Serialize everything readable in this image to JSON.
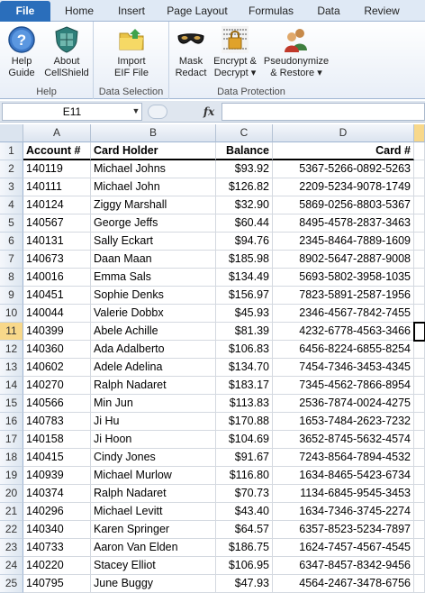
{
  "ribbon": {
    "tabs": [
      "File",
      "Home",
      "Insert",
      "Page Layout",
      "Formulas",
      "Data",
      "Review"
    ],
    "groups": [
      {
        "label": "Help",
        "buttons": [
          {
            "line1": "Help",
            "line2": "Guide",
            "icon": "help-icon"
          },
          {
            "line1": "About",
            "line2": "CellShield",
            "icon": "shield-icon"
          }
        ]
      },
      {
        "label": "Data Selection",
        "buttons": [
          {
            "line1": "Import",
            "line2": "EIF File",
            "icon": "folder-icon"
          }
        ]
      },
      {
        "label": "Data Protection",
        "buttons": [
          {
            "line1": "Mask",
            "line2": "Redact",
            "icon": "mask-icon"
          },
          {
            "line1": "Encrypt &",
            "line2": "Decrypt ▾",
            "icon": "lock-icon"
          },
          {
            "line1": "Pseudonymize",
            "line2": "& Restore ▾",
            "icon": "people-icon"
          }
        ]
      }
    ]
  },
  "formula_bar": {
    "name_box": "E11",
    "fx": "fx",
    "value": ""
  },
  "grid": {
    "columns": [
      "A",
      "B",
      "C",
      "D"
    ],
    "selected_cell": "E11",
    "headers": [
      "Account #",
      "Card Holder",
      "Balance",
      "Card #"
    ],
    "rows": [
      [
        "140119",
        "Michael Johns",
        "$93.92",
        "5367-5266-0892-5263"
      ],
      [
        "140111",
        "Michael John",
        "$126.82",
        "2209-5234-9078-1749"
      ],
      [
        "140124",
        "Ziggy Marshall",
        "$32.90",
        "5869-0256-8803-5367"
      ],
      [
        "140567",
        "George Jeffs",
        "$60.44",
        "8495-4578-2837-3463"
      ],
      [
        "140131",
        "Sally Eckart",
        "$94.76",
        "2345-8464-7889-1609"
      ],
      [
        "140673",
        "Daan Maan",
        "$185.98",
        "8902-5647-2887-9008"
      ],
      [
        "140016",
        "Emma Sals",
        "$134.49",
        "5693-5802-3958-1035"
      ],
      [
        "140451",
        "Sophie Denks",
        "$156.97",
        "7823-5891-2587-1956"
      ],
      [
        "140044",
        "Valerie Dobbx",
        "$45.93",
        "2346-4567-7842-7455"
      ],
      [
        "140399",
        "Abele Achille",
        "$81.39",
        "4232-6778-4563-3466"
      ],
      [
        "140360",
        "Ada Adalberto",
        "$106.83",
        "6456-8224-6855-8254"
      ],
      [
        "140602",
        "Adele Adelina",
        "$134.70",
        "7454-7346-3453-4345"
      ],
      [
        "140270",
        "Ralph Nadaret",
        "$183.17",
        "7345-4562-7866-8954"
      ],
      [
        "140566",
        "Min Jun",
        "$113.83",
        "2536-7874-0024-4275"
      ],
      [
        "140783",
        "Ji Hu",
        "$170.88",
        "1653-7484-2623-7232"
      ],
      [
        "140158",
        "Ji Hoon",
        "$104.69",
        "3652-8745-5632-4574"
      ],
      [
        "140415",
        "Cindy Jones",
        "$91.67",
        "7243-8564-7894-4532"
      ],
      [
        "140939",
        "Michael Murlow",
        "$116.80",
        "1634-8465-5423-6734"
      ],
      [
        "140374",
        "Ralph Nadaret",
        "$70.73",
        "1134-6845-9545-3453"
      ],
      [
        "140296",
        "Michael Levitt",
        "$43.40",
        "1634-7346-3745-2274"
      ],
      [
        "140340",
        "Karen Springer",
        "$64.57",
        "6357-8523-5234-7897"
      ],
      [
        "140733",
        "Aaron Van Elden",
        "$186.75",
        "1624-7457-4567-4545"
      ],
      [
        "140220",
        "Stacey Elliot",
        "$106.95",
        "6347-8457-8342-9456"
      ],
      [
        "140795",
        "June Buggy",
        "$47.93",
        "4564-2467-3478-6756"
      ]
    ]
  }
}
